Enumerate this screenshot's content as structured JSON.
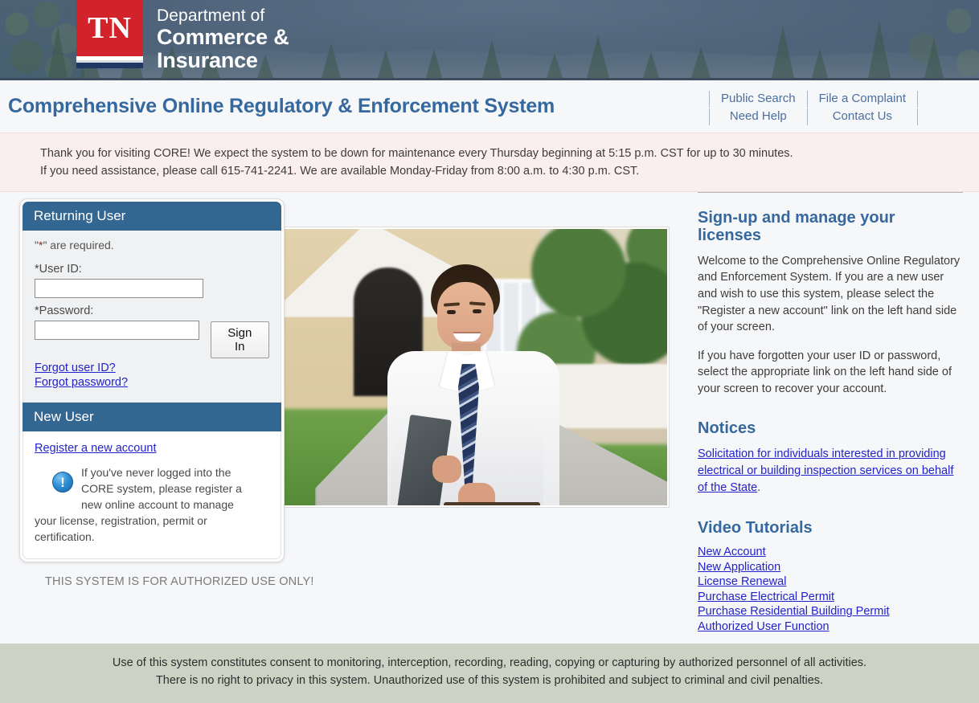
{
  "banner": {
    "logo_initials": "TN",
    "dept_line1": "Department of",
    "dept_line2": "Commerce &",
    "dept_line3": "Insurance",
    "brand_red": "#d2232a",
    "brand_navy": "#1f3864"
  },
  "header": {
    "app_title": "Comprehensive Online Regulatory & Enforcement System",
    "title_color": "#35689e",
    "nav": {
      "public_search": "Public Search",
      "file_a_complaint": "File a Complaint",
      "need_help": "Need Help",
      "contact_us": "Contact Us"
    }
  },
  "alert": {
    "line1": "Thank you for visiting CORE! We expect the system to be down for maintenance every Thursday beginning at 5:15 p.m. CST for up to 30 minutes.",
    "line2": "If you need assistance, please call 615-741-2241. We are available Monday-Friday from 8:00 a.m. to 4:30 p.m. CST.",
    "background": "#fbeeee"
  },
  "login": {
    "returning_user_title": "Returning User",
    "required_note_pre": "\"",
    "required_note_star": "*",
    "required_note_post": "\" are required.",
    "user_id_label": "*User ID:",
    "user_id_value": "",
    "password_label": "*Password:",
    "password_value": "",
    "sign_in_label": "Sign In",
    "forgot_user_id": "Forgot user ID?",
    "forgot_password": "Forgot password?",
    "new_user_title": "New User",
    "register_link": "Register a new account",
    "info_icon_glyph": "!",
    "info_text_line1": "If you've never logged into the",
    "info_text_line2": "CORE system, please register a",
    "info_text_line3": "new online account to manage",
    "info_text_line4": "your license, registration, permit or",
    "info_text_line5": "certification.",
    "header_color": "#336690"
  },
  "authorized_notice": "THIS SYSTEM IS FOR AUTHORIZED USE ONLY!",
  "sidebar": {
    "signup_heading": "Sign-up and manage your licenses",
    "signup_paragraph1": "Welcome to the Comprehensive Online Regulatory and Enforcement System. If you are a new user and wish to use this system, please select the \"Register a new account\" link on the left hand side of your screen.",
    "signup_paragraph2": "If you have forgotten your user ID or password, select the appropriate link on the left hand side of your screen to recover your account.",
    "notices_heading": "Notices",
    "notice_link": "Solicitation for individuals interested in providing electrical or building inspection services on behalf of the State",
    "notice_tail": ".",
    "video_heading": "Video Tutorials",
    "video_links": [
      "New Account",
      "New Application",
      "License Renewal",
      "Purchase Electrical Permit",
      "Purchase Residential Building Permit",
      "Authorized User Function"
    ]
  },
  "footer": {
    "line1": "Use of this system constitutes consent to monitoring, interception, recording, reading, copying or capturing by authorized personnel of all activities.",
    "line2": "There is no right to privacy in this system. Unauthorized use of this system is prohibited and subject to criminal and civil penalties.",
    "background": "#ccd3c4"
  }
}
